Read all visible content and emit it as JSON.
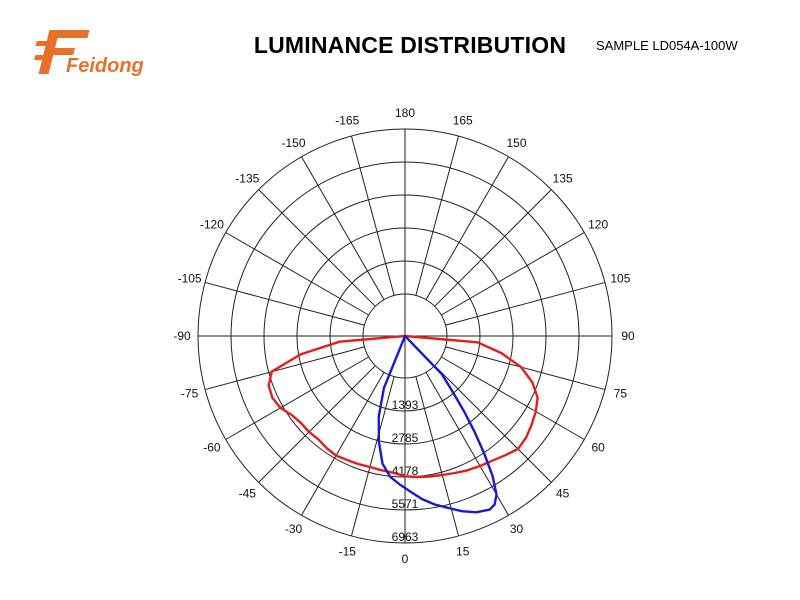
{
  "header": {
    "brand": "Feidong",
    "title": "LUMINANCE DISTRIBUTION",
    "sample": "SAMPLE  LD054A-100W"
  },
  "colors": {
    "logo": "#e8712a",
    "grid": "#222222",
    "series_red": "#e02020",
    "series_blue": "#1a1acc"
  },
  "chart_data": {
    "type": "polar",
    "title": "LUMINANCE DISTRIBUTION",
    "angle_ticks": [
      "180",
      "165",
      "150",
      "135",
      "120",
      "105",
      "90",
      "75",
      "60",
      "45",
      "30",
      "15",
      "0",
      "-15",
      "-30",
      "-45",
      "-60",
      "-75",
      "-90",
      "-105",
      "-120",
      "-135",
      "-150",
      "-165"
    ],
    "radial_ticks": [
      1393,
      2785,
      4178,
      5571,
      6963
    ],
    "r_max": 6963,
    "grid": true,
    "series": [
      {
        "color": "#e02020",
        "points": [
          [
            -90,
            0
          ],
          [
            -85,
            1000
          ],
          [
            -80,
            2700
          ],
          [
            -75,
            4050
          ],
          [
            -70,
            4350
          ],
          [
            -65,
            4400
          ],
          [
            -60,
            4300
          ],
          [
            -55,
            4050
          ],
          [
            -50,
            3950
          ],
          [
            -45,
            3950
          ],
          [
            -40,
            3920
          ],
          [
            -35,
            4000
          ],
          [
            -30,
            4050
          ],
          [
            -25,
            4000
          ],
          [
            -20,
            3980
          ],
          [
            -15,
            3950
          ],
          [
            -10,
            3980
          ],
          [
            -5,
            4020
          ],
          [
            0,
            4150
          ],
          [
            5,
            4200
          ],
          [
            10,
            4250
          ],
          [
            15,
            4300
          ],
          [
            20,
            4380
          ],
          [
            25,
            4480
          ],
          [
            30,
            4560
          ],
          [
            35,
            4650
          ],
          [
            40,
            4800
          ],
          [
            45,
            4970
          ],
          [
            50,
            4900
          ],
          [
            55,
            4750
          ],
          [
            60,
            4600
          ],
          [
            65,
            4400
          ],
          [
            70,
            3950
          ],
          [
            75,
            3300
          ],
          [
            80,
            2350
          ],
          [
            85,
            1300
          ],
          [
            90,
            0
          ]
        ]
      },
      {
        "color": "#1a1acc",
        "points": [
          [
            -25,
            0
          ],
          [
            -22,
            600
          ],
          [
            -18,
            1800
          ],
          [
            -14,
            2800
          ],
          [
            -10,
            3700
          ],
          [
            -6,
            4200
          ],
          [
            -2,
            4500
          ],
          [
            2,
            4800
          ],
          [
            6,
            5150
          ],
          [
            10,
            5450
          ],
          [
            14,
            5700
          ],
          [
            18,
            6000
          ],
          [
            22,
            6250
          ],
          [
            26,
            6380
          ],
          [
            28,
            6280
          ],
          [
            30,
            5950
          ],
          [
            32,
            5200
          ],
          [
            34,
            4200
          ],
          [
            36,
            3200
          ],
          [
            38,
            2300
          ],
          [
            40,
            1500
          ],
          [
            42,
            900
          ],
          [
            44,
            450
          ],
          [
            45,
            0
          ]
        ]
      }
    ]
  }
}
